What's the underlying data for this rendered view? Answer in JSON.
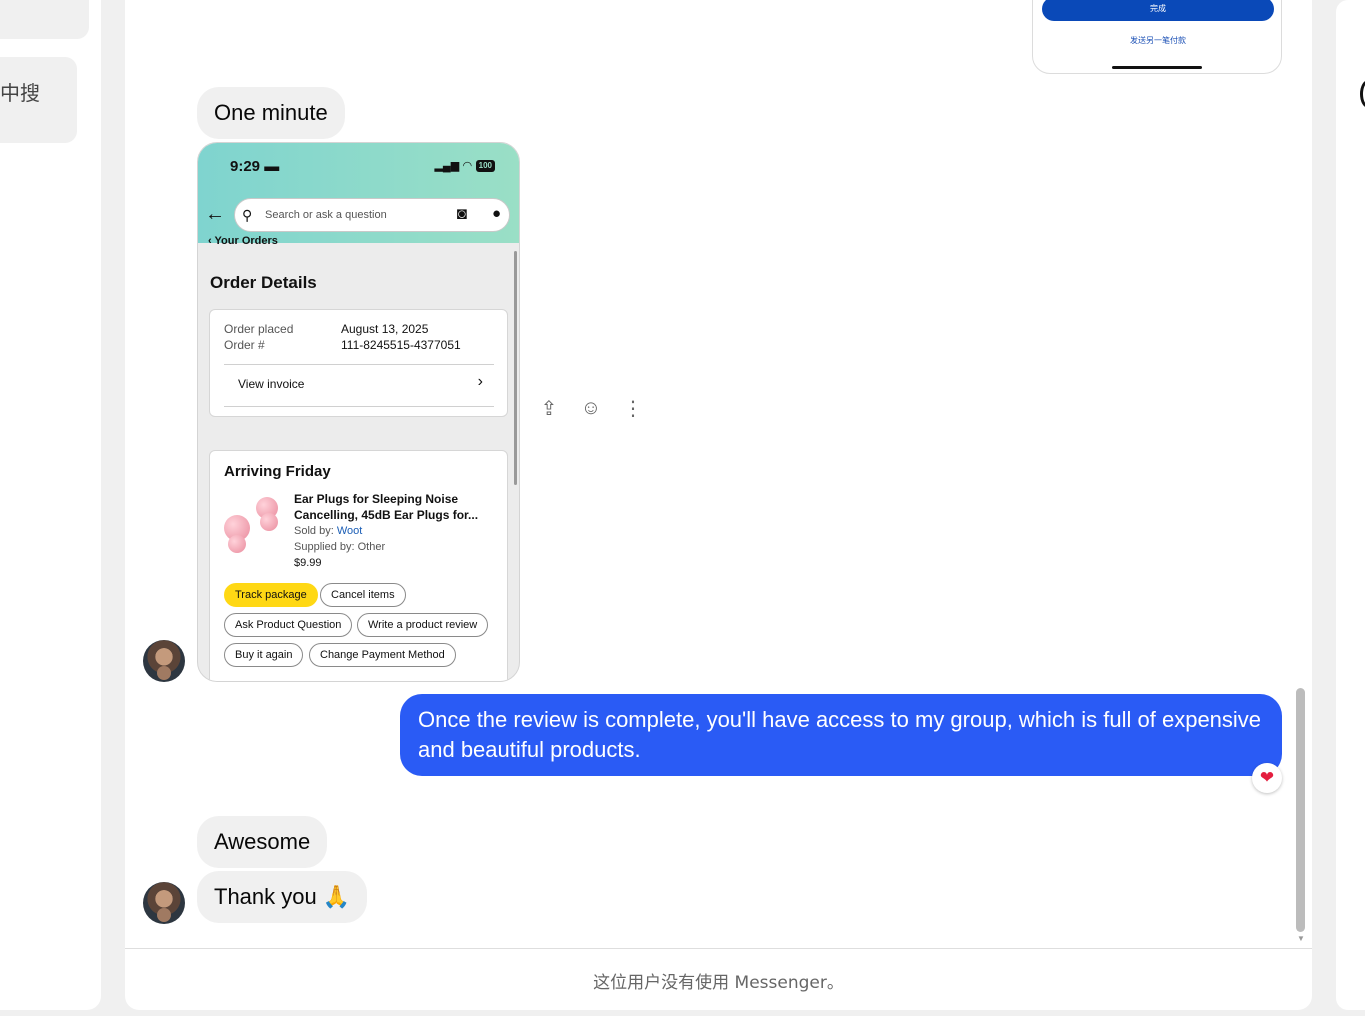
{
  "sidebar": {
    "search_partial": "中搜"
  },
  "previous_message": {
    "done_button": "完成",
    "send_another_link": "发送另一笔付款"
  },
  "messages": {
    "one_minute": "One minute",
    "outgoing": "Once the review is complete, you'll have access to my group, which is full of expensive and beautiful products.",
    "awesome": "Awesome",
    "thank_you": "Thank you 🙏"
  },
  "order_screenshot": {
    "status_time": "9:29",
    "status_car_icon": "car-icon",
    "battery": "100",
    "search_placeholder": "Search or ask a question",
    "your_orders": "Your Orders",
    "title": "Order Details",
    "order_placed_label": "Order placed",
    "order_placed_value": "August 13, 2025",
    "order_number_label": "Order #",
    "order_number_value": "111-8245515-4377051",
    "view_invoice": "View invoice",
    "arriving": "Arriving Friday",
    "product_name": "Ear Plugs for Sleeping Noise Cancelling, 45dB Ear Plugs for...",
    "sold_by_label": "Sold by: ",
    "sold_by_value": "Woot",
    "supplied_by": "Supplied by: Other",
    "price": "$9.99",
    "buttons": {
      "track": "Track package",
      "cancel": "Cancel items",
      "ask": "Ask Product Question",
      "review": "Write a product review",
      "buy_again": "Buy it again",
      "change_payment": "Change Payment Method"
    }
  },
  "message_actions": [
    "share-icon",
    "emoji-icon",
    "more-icon"
  ],
  "reaction": "heart",
  "footer": {
    "notice": "这位用户没有使用 Messenger。"
  },
  "colors": {
    "outgoing_bubble": "#2a5bf5",
    "incoming_bubble": "#f0f0f0",
    "track_button": "#ffd814"
  }
}
